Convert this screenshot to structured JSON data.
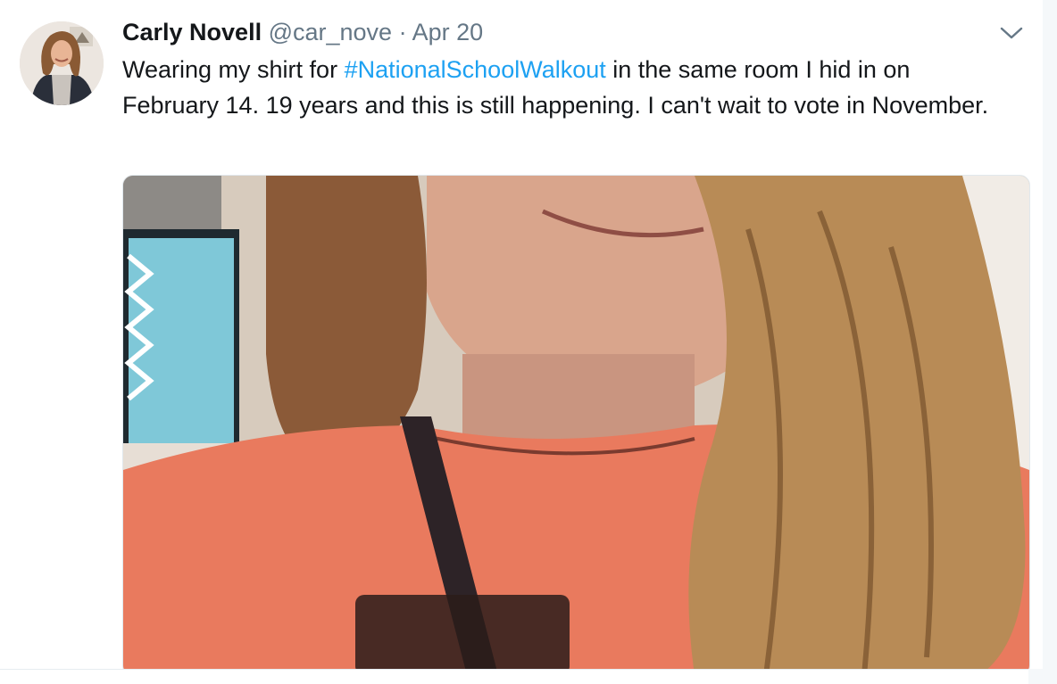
{
  "tweet": {
    "author_name": "Carly Novell",
    "author_handle": "@car_nove",
    "separator": "·",
    "timestamp": "Apr 20",
    "text_before": "Wearing my shirt for ",
    "hashtag": "#NationalSchoolWalkout",
    "text_after": " in the same room I hid in on February 14. 19 years and this is still happening. I can't wait to vote in November.",
    "menu_icon": "chevron-down-icon",
    "avatar_icon": "profile-photo",
    "media_icon": "attached-photo"
  },
  "colors": {
    "background": "#f5f8fa",
    "card": "#ffffff",
    "text": "#14171a",
    "secondary_text": "#657786",
    "link": "#1da1f2",
    "border": "#e1e8ed"
  }
}
